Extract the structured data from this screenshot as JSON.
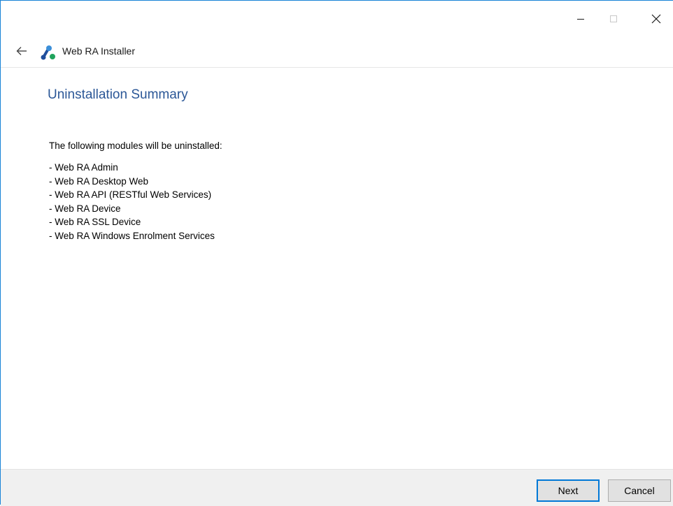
{
  "window": {
    "controls": {
      "minimize_icon": "minimize-icon",
      "maximize_icon": "maximize-icon",
      "close_icon": "close-icon"
    }
  },
  "appbar": {
    "back_icon": "back-arrow-icon",
    "logo_icon": "web-ra-logo-icon",
    "title": "Web RA Installer"
  },
  "page": {
    "title": "Uninstallation Summary",
    "intro": "The following modules will be uninstalled:",
    "modules": [
      "- Web RA Admin",
      "- Web RA Desktop Web",
      "- Web RA API (RESTful Web Services)",
      "- Web RA Device",
      "- Web RA SSL Device",
      "- Web RA Windows Enrolment Services"
    ]
  },
  "footer": {
    "next_label": "Next",
    "cancel_label": "Cancel"
  },
  "colors": {
    "accent": "#0078d7",
    "title_blue": "#2b5797",
    "logo_dark_blue": "#1f4e9c",
    "logo_light_blue": "#3b8fd9",
    "logo_green": "#1fa35c",
    "footer_bg": "#f0f0f0"
  }
}
